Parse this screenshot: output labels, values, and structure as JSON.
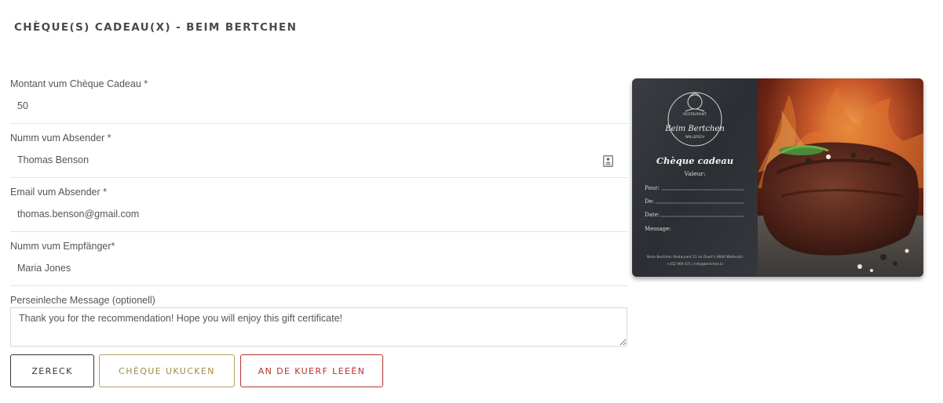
{
  "header": {
    "title": "CHÈQUE(S) CADEAU(X) - BEIM BERTCHEN"
  },
  "form": {
    "amount": {
      "label": "Montant vum Chèque Cadeau *",
      "value": "50"
    },
    "sender_name": {
      "label": "Numm vum Absender *",
      "value": "Thomas Benson"
    },
    "sender_email": {
      "label": "Email vum Absender *",
      "value": "thomas.benson@gmail.com"
    },
    "recipient_name": {
      "label": "Numm vum Empfänger*",
      "value": "Maria Jones"
    },
    "message": {
      "label": "Perseinleche Message (optionell)",
      "value": "Thank you for the recommendation! Hope you will enjoy this gift certificate!"
    }
  },
  "buttons": {
    "back": "ZERECK",
    "preview": "CHÈQUE UKUCKEN",
    "add_to_cart": "AN DE KUERF LEEËN"
  },
  "voucher": {
    "brand_top": "RESTAURANT",
    "brand_name": "Beim Bertchen",
    "brand_bottom": "WALLERSCH",
    "heading": "Chèque cadeau",
    "value_label": "Valeur:",
    "fields": [
      "Pour:",
      "De:",
      "Date:",
      "Message:"
    ],
    "footer_line1": "Beim Bertchen Restaurant 21 an Duerf L-9840 Wallersch",
    "footer_line2": "+352 969 471  |  info@bertchen.lu"
  },
  "icons": {
    "contact_card": "contact-card-icon"
  }
}
